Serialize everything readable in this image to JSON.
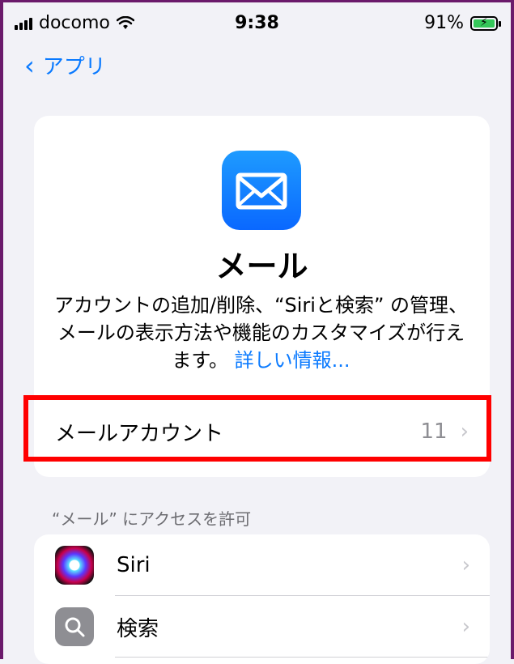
{
  "status_bar": {
    "carrier": "docomo",
    "time": "9:38",
    "battery": "91%"
  },
  "nav": {
    "back_label": "アプリ"
  },
  "app": {
    "name": "メール",
    "description": "アカウントの追加/削除、“Siriと検索” の管理、メールの表示方法や機能のカスタマイズが行えます。",
    "more_info_link": "詳しい情報..."
  },
  "accounts_row": {
    "label": "メールアカウント",
    "count": "11"
  },
  "access_section": {
    "header": "“メール” にアクセスを許可",
    "items": [
      {
        "label": "Siri",
        "icon": "siri-icon"
      },
      {
        "label": "検索",
        "icon": "search-icon"
      }
    ]
  },
  "colors": {
    "accent": "#0a7aff",
    "highlight": "#ff0000",
    "frame": "#6b1a6b",
    "background": "#f2f2f7"
  }
}
